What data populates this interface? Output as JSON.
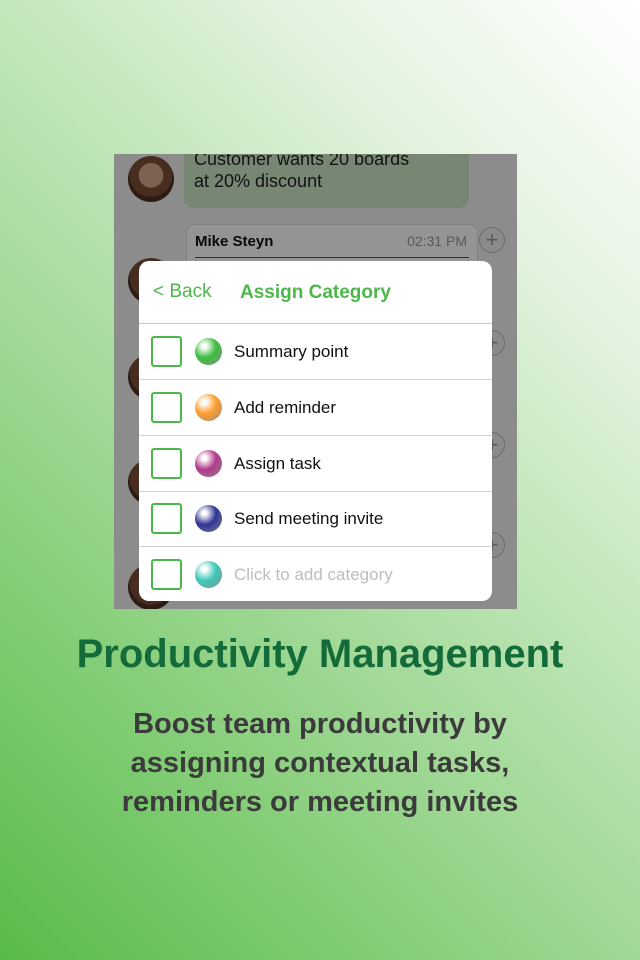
{
  "chat": {
    "message_text": "Customer wants 20 boards at 20% discount",
    "card_sender": "Mike Steyn",
    "card_time": "02:31 PM"
  },
  "modal": {
    "back_label": "< Back",
    "title": "Assign Category",
    "items": [
      {
        "label": "Summary point",
        "color": "#3fbd3f"
      },
      {
        "label": "Add reminder",
        "color": "#ff9d2e"
      },
      {
        "label": "Assign task",
        "color": "#b23a8c"
      },
      {
        "label": "Send meeting invite",
        "color": "#2f3596"
      },
      {
        "label": "Click to add category",
        "color": "#3ec8b8"
      }
    ]
  },
  "headline": "Productivity Management",
  "subtext_lines": [
    "Boost team productivity by",
    "assigning contextual tasks,",
    "reminders or meeting invites"
  ]
}
